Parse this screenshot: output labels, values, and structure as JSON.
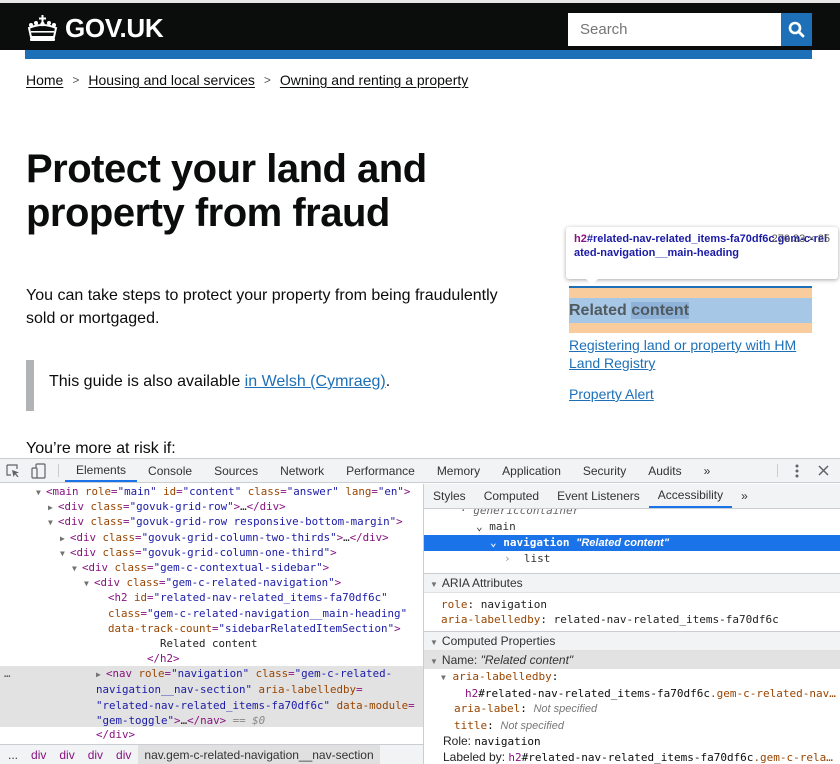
{
  "header": {
    "logo_text": "GOV.UK",
    "search_placeholder": "Search",
    "search_button_label": "Search"
  },
  "breadcrumbs": [
    {
      "label": "Home"
    },
    {
      "label": "Housing and local services"
    },
    {
      "label": "Owning and renting a property"
    }
  ],
  "page": {
    "title": "Protect your land and property from fraud",
    "lead": "You can take steps to protect your property from being fraudulently sold or mortgaged.",
    "inset_prefix": "This guide is also available ",
    "inset_link": "in Welsh (Cymraeg)",
    "inset_suffix": ".",
    "risk_text": "You’re more at risk if:"
  },
  "related": {
    "heading_part1": "Related ",
    "heading_part2": "content",
    "links": [
      {
        "label": "Registering land or property with HM Land Registry"
      },
      {
        "label": "Property Alert"
      }
    ]
  },
  "inspect_tooltip": {
    "tag": "h2",
    "selector": "#related-nav-related_items-fa70df6c.gem-c-related-navigation__main-heading",
    "dimensions": "270.33 × 25"
  },
  "devtools": {
    "tabs": [
      "Elements",
      "Console",
      "Sources",
      "Network",
      "Performance",
      "Memory",
      "Application",
      "Security",
      "Audits"
    ],
    "active_tab": "Elements",
    "more_tabs": "»",
    "side_tabs": [
      "Styles",
      "Computed",
      "Event Listeners",
      "Accessibility"
    ],
    "active_side_tab": "Accessibility",
    "dom": {
      "main_line": {
        "tag": "main",
        "attrs": [
          [
            "role",
            "main"
          ],
          [
            "id",
            "content"
          ],
          [
            "class",
            "answer"
          ],
          [
            "lang",
            "en"
          ]
        ]
      },
      "row1_class": "govuk-grid-row",
      "row2_class": "govuk-grid-row responsive-bottom-margin",
      "col_two_thirds": "govuk-grid-column-two-thirds",
      "col_one_third": "govuk-grid-column-one-third",
      "sidebar_class": "gem-c-contextual-sidebar",
      "related_nav_class": "gem-c-related-navigation",
      "h2_id": "related-nav-related_items-fa70df6c",
      "h2_class": "gem-c-related-navigation__main-heading",
      "h2_track": "sidebarRelatedItemSection",
      "h2_text": "Related content",
      "nav_role": "navigation",
      "nav_class_1": "gem-c-related-",
      "nav_class_2": "navigation__nav-section",
      "nav_labelledby": "related-nav-related_items-fa70df6c",
      "nav_module": "gem-toggle",
      "selected_marker": "== $0"
    },
    "dom_breadcrumb": [
      "...",
      "div",
      "div",
      "div",
      "div",
      "nav.gem-c-related-navigation__nav-section"
    ],
    "ax_tree": {
      "clipped": "genericcontainer",
      "main": "main",
      "selected_role": "navigation",
      "selected_name": "\"Related content\"",
      "child": "list"
    },
    "aria_attributes": {
      "title": "ARIA Attributes",
      "role_key": "role",
      "role_value": "navigation",
      "labelledby_key": "aria-labelledby",
      "labelledby_value": "related-nav-related_items-fa70df6c"
    },
    "computed": {
      "title": "Computed Properties",
      "name_label": "Name: ",
      "name_value": "\"Related content\"",
      "labelledby_key": "aria-labelledby",
      "labelledby_tag": "h2",
      "labelledby_id": "#related-nav-related_items-fa70df6c",
      "labelledby_class": ".gem-c-related-nav…",
      "aria_label_key": "aria-label",
      "not_specified": "Not specified",
      "title_key": "title",
      "role_line_label": "Role: ",
      "role_line_value": "navigation",
      "labeled_by_label": "Labeled by: ",
      "labeled_by_tag": "h2",
      "labeled_by_id": "#related-nav-related_items-fa70df6c",
      "labeled_by_class": ".gem-c-rela…"
    }
  },
  "colors": {
    "govuk_black": "#0b0c0c",
    "govuk_blue": "#1d70b8",
    "devtools_selection": "#1a73e8",
    "margin_highlight": "#f9cc9d",
    "content_highlight": "#a7c7e7"
  }
}
